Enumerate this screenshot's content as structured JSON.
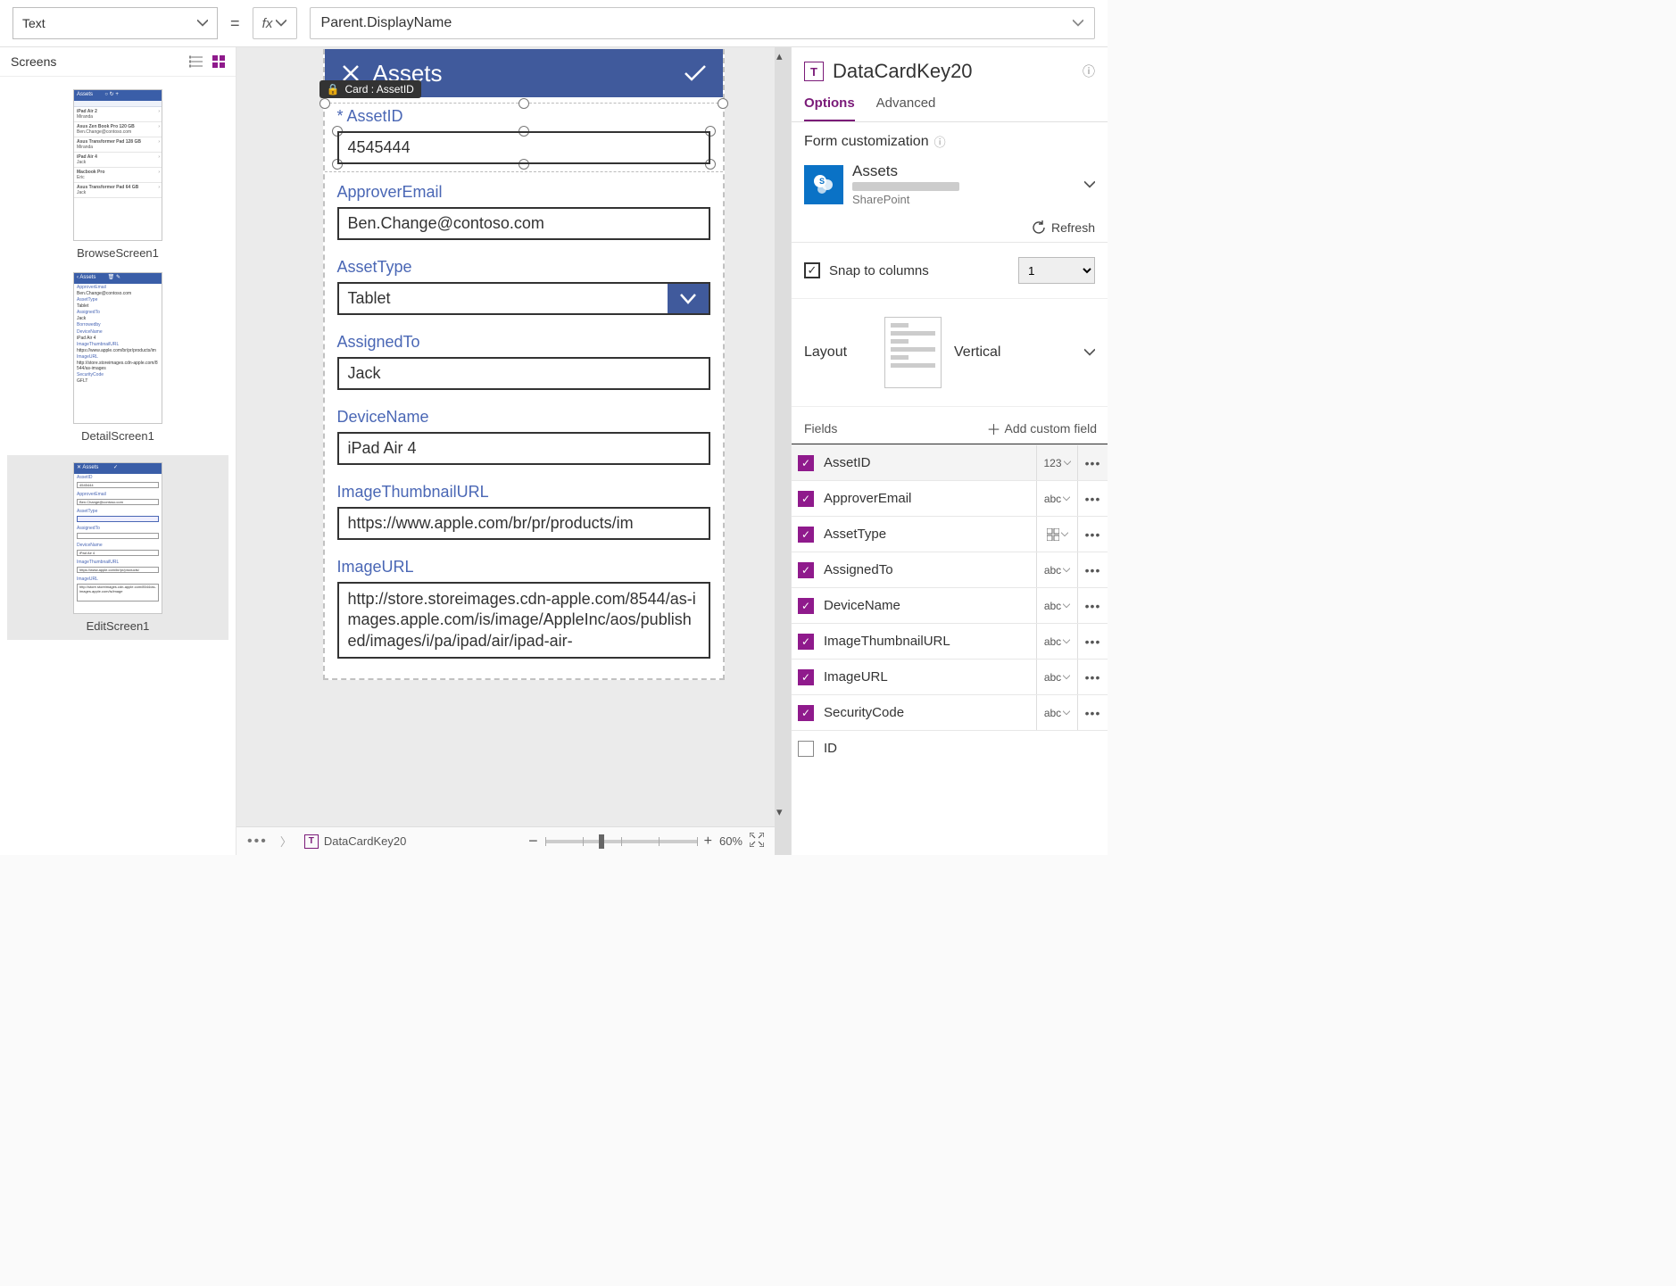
{
  "formulaBar": {
    "property": "Text",
    "fxLabel": "fx",
    "expression": "Parent.DisplayName"
  },
  "treePanel": {
    "title": "Screens",
    "screens": [
      {
        "name": "BrowseScreen1"
      },
      {
        "name": "DetailScreen1"
      },
      {
        "name": "EditScreen1"
      }
    ]
  },
  "canvas": {
    "selectionTooltip": "Card : AssetID",
    "appTitle": "Assets",
    "cards": [
      {
        "label": "AssetID",
        "value": "4545444",
        "required": true,
        "kind": "text",
        "selected": true
      },
      {
        "label": "ApproverEmail",
        "value": "Ben.Change@contoso.com",
        "kind": "text"
      },
      {
        "label": "AssetType",
        "value": "Tablet",
        "kind": "select"
      },
      {
        "label": "AssignedTo",
        "value": "Jack",
        "kind": "text"
      },
      {
        "label": "DeviceName",
        "value": "iPad Air 4",
        "kind": "text"
      },
      {
        "label": "ImageThumbnailURL",
        "value": "https://www.apple.com/br/pr/products/im",
        "kind": "text"
      },
      {
        "label": "ImageURL",
        "value": "http://store.storeimages.cdn-apple.com/8544/as-images.apple.com/is/image/AppleInc/aos/published/images/i/pa/ipad/air/ipad-air-",
        "kind": "textarea"
      }
    ]
  },
  "status": {
    "breadcrumb": "DataCardKey20",
    "zoom": "60%"
  },
  "rightPanel": {
    "controlName": "DataCardKey20",
    "tabs": {
      "options": "Options",
      "advanced": "Advanced"
    },
    "formCustomization": "Form customization",
    "dataSource": {
      "name": "Assets",
      "type": "SharePoint"
    },
    "refresh": "Refresh",
    "snapLabel": "Snap to columns",
    "snapCols": "1",
    "layoutLabel": "Layout",
    "layoutValue": "Vertical",
    "fieldsLabel": "Fields",
    "addCustom": "Add custom field",
    "fields": [
      {
        "name": "AssetID",
        "type": "123",
        "checked": true,
        "selected": true
      },
      {
        "name": "ApproverEmail",
        "type": "abc",
        "checked": true
      },
      {
        "name": "AssetType",
        "type": "grid",
        "checked": true
      },
      {
        "name": "AssignedTo",
        "type": "abc",
        "checked": true
      },
      {
        "name": "DeviceName",
        "type": "abc",
        "checked": true
      },
      {
        "name": "ImageThumbnailURL",
        "type": "abc",
        "checked": true
      },
      {
        "name": "ImageURL",
        "type": "abc",
        "checked": true
      },
      {
        "name": "SecurityCode",
        "type": "abc",
        "checked": true
      },
      {
        "name": "ID",
        "type": "",
        "checked": false
      }
    ]
  }
}
